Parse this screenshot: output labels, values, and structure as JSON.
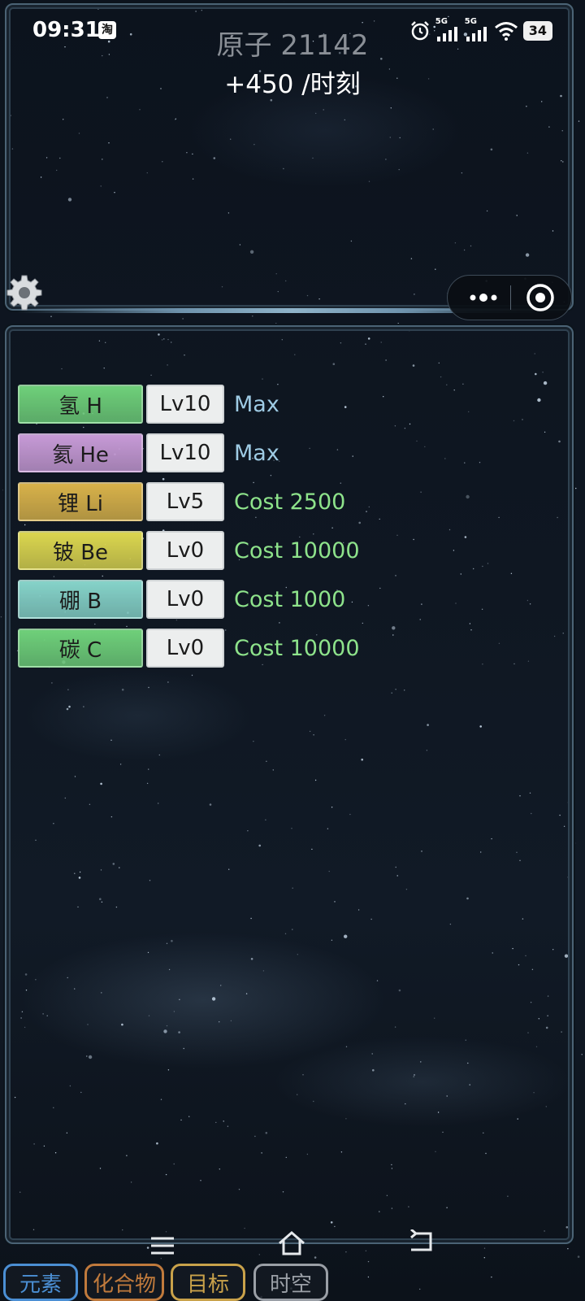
{
  "status_bar": {
    "time": "09:31",
    "app_badge": "淘",
    "signal_1": "5G",
    "signal_2": "5G",
    "battery": "34"
  },
  "header": {
    "atom_count": "原子 21142",
    "rate": "+450 /时刻"
  },
  "elements": [
    {
      "name": "氢 H",
      "level": "Lv10",
      "info": "Max",
      "color": "#6fd07a",
      "info_color": "#9ecbe4"
    },
    {
      "name": "氦 He",
      "level": "Lv10",
      "info": "Max",
      "color": "#c79ad6",
      "info_color": "#9ecbe4"
    },
    {
      "name": "锂 Li",
      "level": "Lv5",
      "info": "Cost 2500",
      "color": "#d8b24a",
      "info_color": "#8ee38b"
    },
    {
      "name": "铍 Be",
      "level": "Lv0",
      "info": "Cost 10000",
      "color": "#dcd64f",
      "info_color": "#8ee38b"
    },
    {
      "name": "硼 B",
      "level": "Lv0",
      "info": "Cost 1000",
      "color": "#86d3c9",
      "info_color": "#8ee38b"
    },
    {
      "name": "碳 C",
      "level": "Lv0",
      "info": "Cost 10000",
      "color": "#6fd07a",
      "info_color": "#8ee38b"
    }
  ],
  "tabs": [
    {
      "label": "元素",
      "color": "#4b8fd4"
    },
    {
      "label": "化合物",
      "color": "#c07a3c"
    },
    {
      "label": "目标",
      "color": "#c9a24a"
    },
    {
      "label": "时空",
      "color": "#9a9fa6"
    }
  ],
  "icons": {
    "settings": "gear-icon",
    "more": "more-dots-icon",
    "close": "target-close-icon",
    "nav_menu": "menu-icon",
    "nav_home": "home-icon",
    "nav_back": "back-icon"
  }
}
